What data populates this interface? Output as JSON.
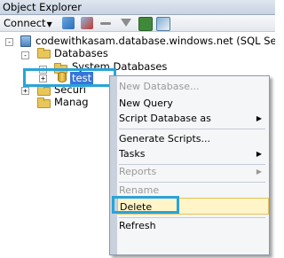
{
  "window": {
    "title": "Object Explorer"
  },
  "toolbar": {
    "connect_label": "Connect",
    "caret": "▼"
  },
  "tree": {
    "server": "codewithkasam.database.windows.net (SQL Server",
    "databases": "Databases",
    "system_databases": "System Databases",
    "selected_db": "test",
    "security": "Securi",
    "management": "Manag",
    "expand_sign": "+",
    "collapse_sign": "-"
  },
  "context_menu": {
    "items": {
      "new_database": "New Database...",
      "new_query": "New Query",
      "script_database_as": "Script Database as",
      "generate_scripts": "Generate Scripts...",
      "tasks": "Tasks",
      "reports": "Reports",
      "rename": "Rename",
      "delete": "Delete",
      "refresh": "Refresh"
    },
    "submenu_arrow": "▶"
  },
  "colors": {
    "highlight": "#29a3d9",
    "menu_hover": "#fff5c8"
  }
}
